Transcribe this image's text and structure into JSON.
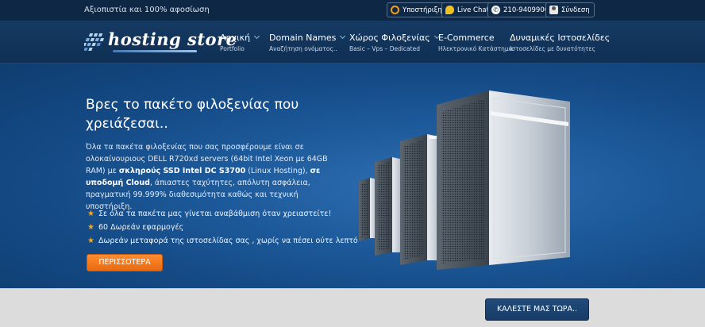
{
  "topbar": {
    "tagline": "Αξιοπιστία και 100% αφοσίωση",
    "support": {
      "label": "Υποστήριξη",
      "icon": "lifebuoy-icon"
    },
    "chat": {
      "label": "Live Chat",
      "icon": "chat-bubble-icon"
    },
    "phone": {
      "label": "210-9409900",
      "icon": "phone-icon"
    },
    "login": {
      "label": "Σύνδεση",
      "icon": "user-icon"
    }
  },
  "logo": {
    "text": "hosting store"
  },
  "nav": {
    "items": [
      {
        "title": "Αρχική",
        "subtitle": "Portfolio"
      },
      {
        "title": "Domain Names",
        "subtitle": "Αναζήτηση ονόματος.."
      },
      {
        "title": "Χώρος Φιλοξενίας",
        "subtitle": "Basic – Vps – Dedicated"
      },
      {
        "title": "E-Commerce",
        "subtitle": "Ηλεκτρονικό Κατάστημα"
      },
      {
        "title": "Δυναμικές Ιστοσελίδες",
        "subtitle": "Ιστοσελίδες με δυνατότητες"
      }
    ]
  },
  "hero": {
    "title": "Βρες το πακέτο φιλοξενίας που χρειάζεσαι..",
    "desc_1": "Όλα τα πακέτα φιλοξενίας που σας προσφέρουμε είναι σε ολοκαίνουριους  DELL R720xd servers (64bit Intel Xeon με 64GB RAM) με ",
    "desc_bold_1": "σκληρούς SSD Intel DC S3700",
    "desc_2": " (Linux Hosting), ",
    "desc_bold_2": "σε υποδομή Cloud",
    "desc_3": ", άπιαστες ταχύτητες, απόλυτη ασφάλεια, πραγματική 99.999% διαθεσιμότητα καθώς και τεχνική υποστήριξη.",
    "features": [
      "Σε όλα τα πακέτα μας γίνεται αναβάθμιση όταν χρειαστείτε!",
      "60 Δωρεάν εφαρμογές",
      "Δωρεάν μεταφορά της ιστοσελίδας σας , χωρίς να πέσει ούτε λεπτό"
    ],
    "more_label": "ΠΕΡΙΣΣΟΤΕΡΑ"
  },
  "footer_band": {
    "call_label": "ΚΑΛΕΣΤΕ ΜΑΣ ΤΩΡΑ.."
  },
  "colors": {
    "accent_orange": "#f07818",
    "navy": "#0d2744",
    "star": "#f5a623"
  }
}
